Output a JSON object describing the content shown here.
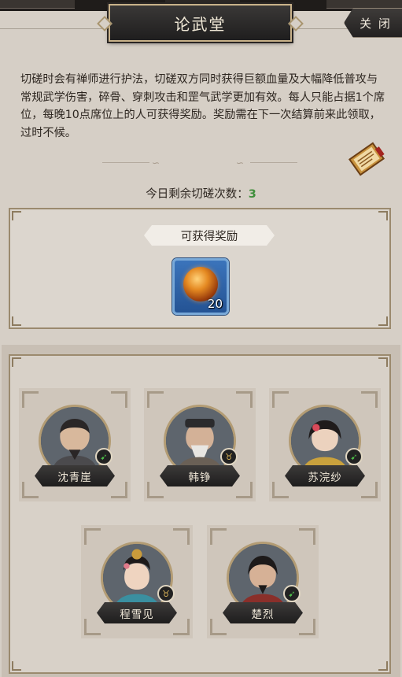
{
  "header": {
    "title": "论武堂",
    "close_label": "关 闭"
  },
  "description": "切磋时会有禅师进行护法，切磋双方同时获得巨额血量及大幅降低普攻与常规武学伤害，碎骨、穿刺攻击和罡气武学更加有效。每人只能占据1个席位，每晚10点席位上的人可获得奖励。奖励需在下一次结算前来此领取，过时不候。",
  "remaining": {
    "label": "今日剩余切磋次数：",
    "count": "3"
  },
  "reward": {
    "label": "可获得奖励",
    "item_icon": "fire-orb-icon",
    "item_count": "20"
  },
  "seats": [
    {
      "name": "沈青崖",
      "faction_icon": "green-leaf-icon"
    },
    {
      "name": "韩铮",
      "faction_icon": "gold-ox-icon"
    },
    {
      "name": "苏浣纱",
      "faction_icon": "green-leaf-icon"
    },
    {
      "name": "程雪见",
      "faction_icon": "gold-ox-icon"
    },
    {
      "name": "楚烈",
      "faction_icon": "green-leaf-icon"
    }
  ],
  "colors": {
    "accent_green": "#3f8f3b",
    "item_bg": "#2f62a8",
    "panel_bg": "#d6cfc6"
  }
}
